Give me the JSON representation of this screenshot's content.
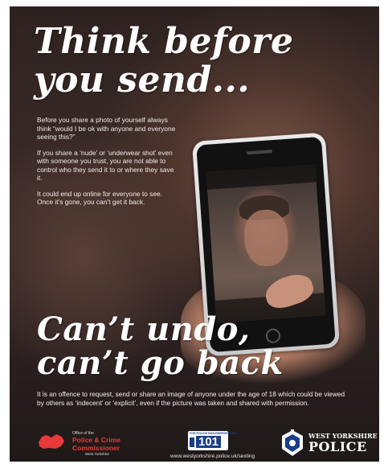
{
  "headline": {
    "line1": "Think before",
    "line2": "you send..."
  },
  "intro": [
    "Before you share a photo of yourself always think “would I be ok with anyone and everyone seeing this?”",
    "If you share a ‘nude’ or ‘underwear shot’ even with someone you trust, you are not able to control who they send it to or where they save it.",
    "It could end up online for everyone to see. Once it’s gone, you can’t get it back."
  ],
  "slogan": {
    "line1": "Can’t undo,",
    "line2": "can’t go back"
  },
  "body_text": "It is an offence to request, send or share an image of anyone under the age of 18 which could be viewed by others as ‘indecent’ or ‘explicit’, even if the picture was taken and shared with permission.",
  "logos": {
    "pcc": {
      "office_of": "Office of the",
      "name_line1": "Police & Crime",
      "name_line2": "Commissioner",
      "region": "West Yorkshire"
    },
    "badge_101": {
      "top": "FOR POLICE NON-EMERGENCIES",
      "number": "101"
    },
    "wyp": {
      "line1": "WEST YORKSHIRE",
      "line2": "POLICE"
    }
  },
  "url": "www.westyorkshire.police.uk/sexting",
  "colors": {
    "accent_red": "#e83a3a",
    "badge_blue": "#1a3e8a"
  }
}
